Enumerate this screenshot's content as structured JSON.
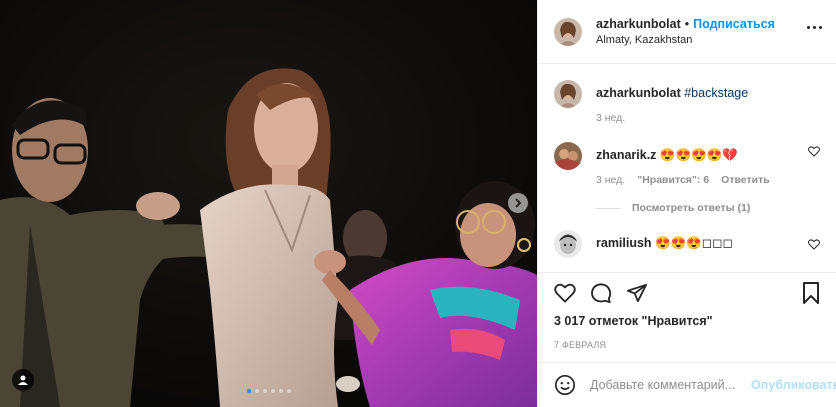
{
  "post": {
    "author": "azharkunbolat",
    "separator": "•",
    "follow_label": "Подписаться",
    "location": "Almaty, Kazakhstan",
    "caption_hashtag": "#backstage",
    "caption_time": "3 нед.",
    "carousel": {
      "total_slides": 6,
      "active_slide": 1
    }
  },
  "comments": [
    {
      "username": "zhanarik.z",
      "text": "😍😍😍😍💔",
      "time": "3 нед.",
      "likes_label": "\"Нравится\": 6",
      "reply_label": "Ответить",
      "view_replies": "Посмотреть ответы (1)"
    },
    {
      "username": "ramiliush",
      "text": "😍😍😍◻◻◻"
    }
  ],
  "actions": {
    "likes_count": "3 017 отметок \"Нравится\"",
    "date": "7 февраля",
    "comment_placeholder": "Добавьте комментарий...",
    "publish_label": "Опубликовать"
  },
  "icons": [
    "more-icon",
    "like-icon",
    "comment-icon",
    "share-icon",
    "save-icon",
    "emoji-icon",
    "tag-user-icon",
    "chevron-right-icon"
  ]
}
